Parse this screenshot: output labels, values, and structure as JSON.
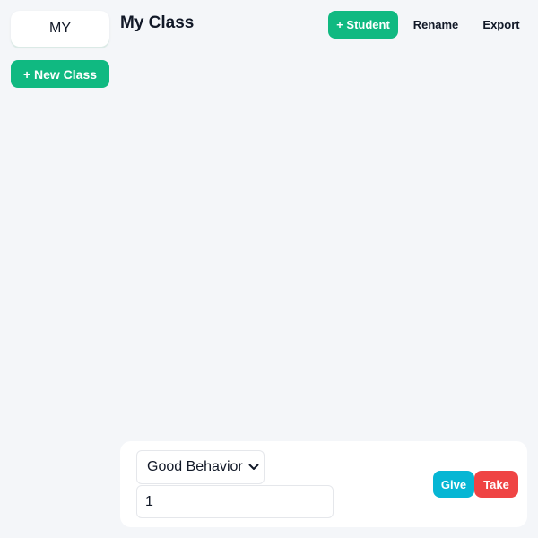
{
  "sidebar": {
    "class_tab_label": "MY",
    "new_class_label": "+ New Class"
  },
  "header": {
    "title": "My Class",
    "add_student_label": "+ Student",
    "rename_label": "Rename",
    "export_label": "Export"
  },
  "action_panel": {
    "behavior_selected": "Good Behavior",
    "points_value": "1",
    "give_label": "Give",
    "take_label": "Take"
  },
  "colors": {
    "primary_green": "#10b981",
    "give_cyan": "#06b6d4",
    "take_red": "#ef4444",
    "background": "#f4f6f9"
  },
  "icons": {
    "select_chevron": "chevron-down-icon"
  }
}
